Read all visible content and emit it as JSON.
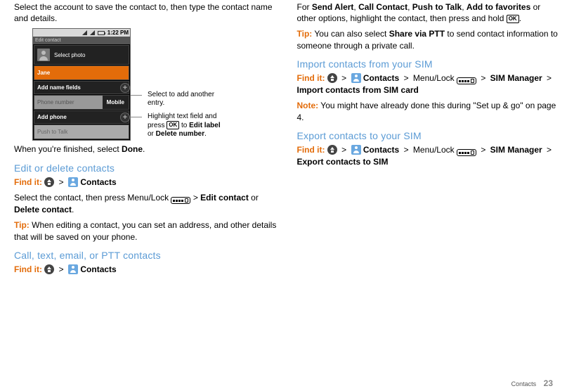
{
  "left": {
    "intro": "Select the account to save the contact to, then type the contact name and details.",
    "phone": {
      "time": "1:22 PM",
      "titlebar": "Edit contact",
      "select_photo": "Select photo",
      "name_value": "Jane",
      "add_name_fields": "Add name fields",
      "phone_placeholder": "Phone number",
      "phone_type": "Mobile",
      "add_phone": "Add phone",
      "push_to_talk": "Push to Talk"
    },
    "callout1": "Select to add another entry.",
    "callout2_pre": "Highlight text field and press ",
    "callout2_post": " to Edit label or Delete number.",
    "done_line_pre": "When you're finished, select ",
    "done_word": "Done",
    "editdelete": {
      "title": "Edit or delete contacts",
      "findit": "Find it:",
      "contacts": "Contacts",
      "body_pre": "Select the contact, then press Menu/Lock ",
      "body_mid": " > ",
      "edit_contact": "Edit contact",
      "or": " or ",
      "delete_contact": "Delete contact",
      "tip_label": "Tip:",
      "tip_body": " When editing a contact, you can set an address, and other details that will be saved on your phone."
    },
    "ctep": {
      "title": "Call, text, email, or PTT contacts",
      "findit": "Find it:",
      "contacts": "Contacts"
    }
  },
  "right": {
    "para1_pre": "For ",
    "send_alert": "Send Alert",
    "call_contact": "Call Contact",
    "ptt": "Push to Talk",
    "add_fav": "Add to favorites",
    "para1_mid": " or other options, highlight the contact, then press and hold ",
    "tip_label": "Tip:",
    "tip_body_pre": " You can also select ",
    "share_via": "Share via PTT",
    "tip_body_post": " to send contact information to someone through a private call.",
    "import": {
      "title": "Import contacts from your SIM",
      "findit": "Find it:",
      "contacts": "Contacts",
      "sim_mgr": "SIM Manager",
      "import_from": "Import contacts from SIM card",
      "chev": ">",
      "note_label": "Note:",
      "note_body": " You might have already done this during \"Set up & go\" on page 4."
    },
    "export": {
      "title": "Export contacts to your SIM",
      "findit": "Find it:",
      "contacts": "Contacts",
      "sim_mgr": "SIM Manager",
      "export_to": "Export contacts to SIM",
      "chev": ">"
    }
  },
  "footer": {
    "section": "Contacts",
    "page": "23"
  },
  "keys": {
    "ok": "OK",
    "menulock": "Menu/Lock"
  }
}
